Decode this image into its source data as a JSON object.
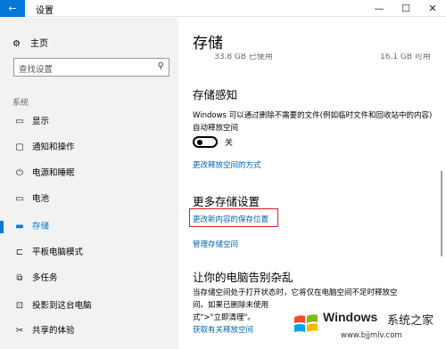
{
  "window": {
    "back_glyph": "←",
    "title": "设置",
    "minimize": "—",
    "maximize": "☐",
    "close": "✕"
  },
  "sidebar": {
    "home_label": "主页",
    "search_placeholder": "查找设置",
    "section_label": "系统",
    "items": [
      {
        "label": "显示",
        "icon": "monitor-icon",
        "glyph": "▭"
      },
      {
        "label": "通知和操作",
        "icon": "notification-icon",
        "glyph": "▢"
      },
      {
        "label": "电源和睡眠",
        "icon": "power-icon",
        "glyph": "⏻"
      },
      {
        "label": "电池",
        "icon": "battery-icon",
        "glyph": "▭"
      },
      {
        "label": "存储",
        "icon": "storage-icon",
        "glyph": "▬",
        "active": true
      },
      {
        "label": "平板电脑模式",
        "icon": "tablet-icon",
        "glyph": "⊏"
      },
      {
        "label": "多任务",
        "icon": "multitask-icon",
        "glyph": "⧉"
      },
      {
        "label": "投影到这台电脑",
        "icon": "project-icon",
        "glyph": "⊡"
      },
      {
        "label": "共享的体验",
        "icon": "share-icon",
        "glyph": "✂"
      }
    ]
  },
  "main": {
    "title": "存储",
    "drive_used": "33.8 GB 已使用",
    "drive_free": "16.1 GB 可用",
    "storage_sense": {
      "heading": "存储感知",
      "description": "Windows 可以通过删除不需要的文件(例如临时文件和回收站中的内容)自动释放空间",
      "toggle_state": "关",
      "toggle_on": false,
      "link": "更改释放空间的方式"
    },
    "more_settings": {
      "heading": "更多存储设置",
      "link_change_location": "更改新内容的保存位置",
      "link_manage": "管理存储空间"
    },
    "declutter": {
      "heading": "让你的电脑告别杂乱",
      "line1": "当存储空间处于打开状态时，它将仅在电脑空间不足时释放空",
      "line2": "间。如果已删除未使用",
      "line3": "式\">\"立即清理\"。",
      "link": "获取有关释放空间"
    }
  },
  "watermark": {
    "brand": "Windows",
    "cn": "系统之家",
    "url": "www.bjjmlv.com",
    "colors": [
      "#f25022",
      "#7fba00",
      "#00a4ef",
      "#ffb900"
    ]
  },
  "colors": {
    "accent": "#0078d7",
    "link": "#0063b1",
    "highlight_box": "#e02020",
    "sidebar_bg": "#f2f2f2"
  }
}
